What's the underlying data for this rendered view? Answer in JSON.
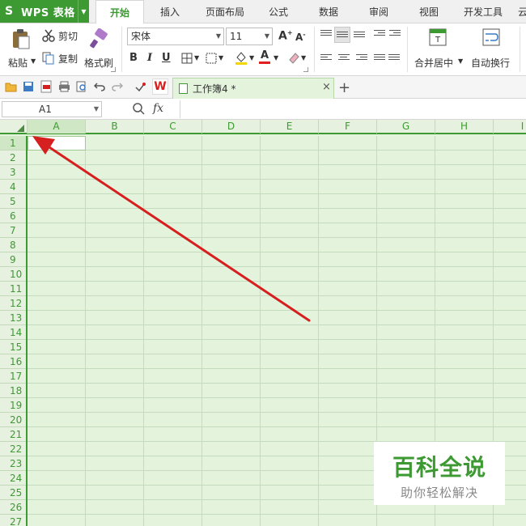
{
  "app": {
    "title": "WPS 表格"
  },
  "tabs": [
    {
      "label": "开始",
      "active": true
    },
    {
      "label": "插入"
    },
    {
      "label": "页面布局"
    },
    {
      "label": "公式"
    },
    {
      "label": "数据"
    },
    {
      "label": "审阅"
    },
    {
      "label": "视图"
    },
    {
      "label": "开发工具"
    },
    {
      "label": "云"
    }
  ],
  "ribbon": {
    "paste": "粘贴",
    "cut": "剪切",
    "copy": "复制",
    "format_painter": "格式刷",
    "font_name": "宋体",
    "font_size": "11",
    "bold": "B",
    "italic": "I",
    "underline": "U",
    "merge_center": "合并居中",
    "wrap_text": "自动换行"
  },
  "document": {
    "tab_name": "工作簿4 *",
    "close": "×",
    "new_tab": "+"
  },
  "formula_bar": {
    "cell_ref": "A1",
    "fx": "fx",
    "content": ""
  },
  "sheet": {
    "columns": [
      "A",
      "B",
      "C",
      "D",
      "E",
      "F",
      "G",
      "H",
      "I"
    ],
    "rows": [
      "1",
      "2",
      "3",
      "4",
      "5",
      "6",
      "7",
      "8",
      "9",
      "10",
      "11",
      "12",
      "13",
      "14",
      "15",
      "16",
      "17",
      "18",
      "19",
      "20",
      "21",
      "22",
      "23",
      "24",
      "25",
      "26",
      "27"
    ],
    "active_cell": "A1"
  },
  "watermark": {
    "main": "百科全说",
    "sub": "助你轻松解决"
  },
  "colors": {
    "accent": "#3d9a33",
    "grid_bg": "#e3f3dc",
    "arrow": "#d62020"
  }
}
